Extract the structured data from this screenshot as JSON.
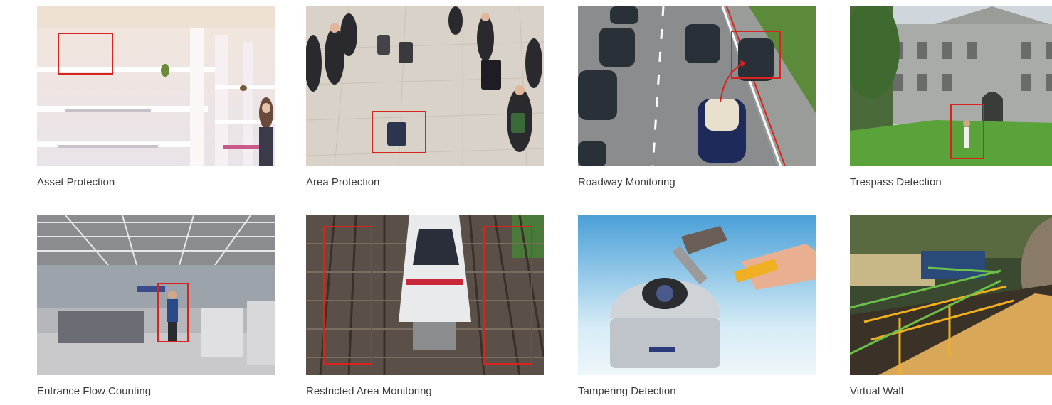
{
  "gallery": {
    "items": [
      {
        "caption": "Asset Protection",
        "image": "store-shelves-photo",
        "overlay": "red-detection-box"
      },
      {
        "caption": "Area Protection",
        "image": "terminal-crowd-photo",
        "overlay": "red-detection-box"
      },
      {
        "caption": "Roadway Monitoring",
        "image": "highway-traffic-photo",
        "overlay": "red-detection-box-and-line"
      },
      {
        "caption": "Trespass Detection",
        "image": "building-lawn-photo",
        "overlay": "red-detection-box"
      },
      {
        "caption": "Entrance Flow Counting",
        "image": "airport-hall-photo",
        "overlay": "red-detection-box"
      },
      {
        "caption": "Restricted Area Monitoring",
        "image": "railway-train-photo",
        "overlay": "red-detection-boxes"
      },
      {
        "caption": "Tampering Detection",
        "image": "dome-camera-hammer-photo",
        "overlay": "none"
      },
      {
        "caption": "Virtual Wall",
        "image": "industrial-walkway-photo",
        "overlay": "green-virtual-lines"
      }
    ]
  },
  "colors": {
    "detection_box": "#d8231f",
    "virtual_line": "#6cc04a",
    "caption_text": "#3a3a3a"
  }
}
